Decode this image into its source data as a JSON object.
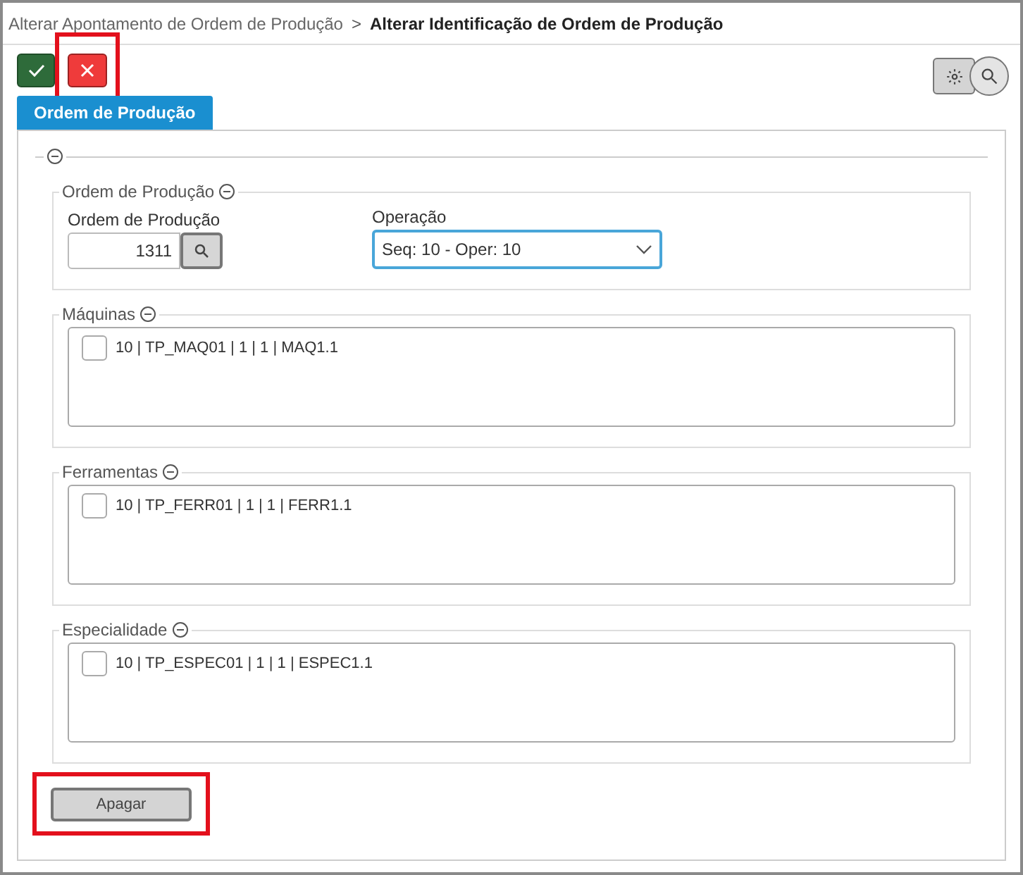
{
  "breadcrumb": {
    "parent": "Alterar Apontamento de Ordem de Produção",
    "separator": ">",
    "current": "Alterar Identificação de Ordem de Produção"
  },
  "toolbar": {
    "buttons": [
      {
        "kind": "confirm",
        "highlighted": false
      },
      {
        "kind": "cancel",
        "highlighted": true
      }
    ],
    "right_buttons": [
      {
        "kind": "settings"
      },
      {
        "kind": "search"
      }
    ]
  },
  "tabs": [
    {
      "label": "Ordem de Produção",
      "selected": true
    }
  ],
  "order_section": {
    "legend": "Ordem de Produção",
    "order_label": "Ordem de Produção",
    "order_value": "1311",
    "operation_label": "Operação",
    "operation_value": "Seq: 10 - Oper: 10"
  },
  "lists": [
    {
      "legend": "Máquinas",
      "items": [
        {
          "text": "10 | TP_MAQ01 | 1 | 1 | MAQ1.1",
          "checked": false
        }
      ]
    },
    {
      "legend": "Ferramentas",
      "items": [
        {
          "text": "10 | TP_FERR01 | 1 | 1 | FERR1.1",
          "checked": false
        }
      ]
    },
    {
      "legend": "Especialidade",
      "items": [
        {
          "text": "10 | TP_ESPEC01 | 1 | 1 | ESPEC1.1",
          "checked": false
        }
      ]
    }
  ],
  "delete_button": {
    "label": "Apagar",
    "highlighted": true
  }
}
